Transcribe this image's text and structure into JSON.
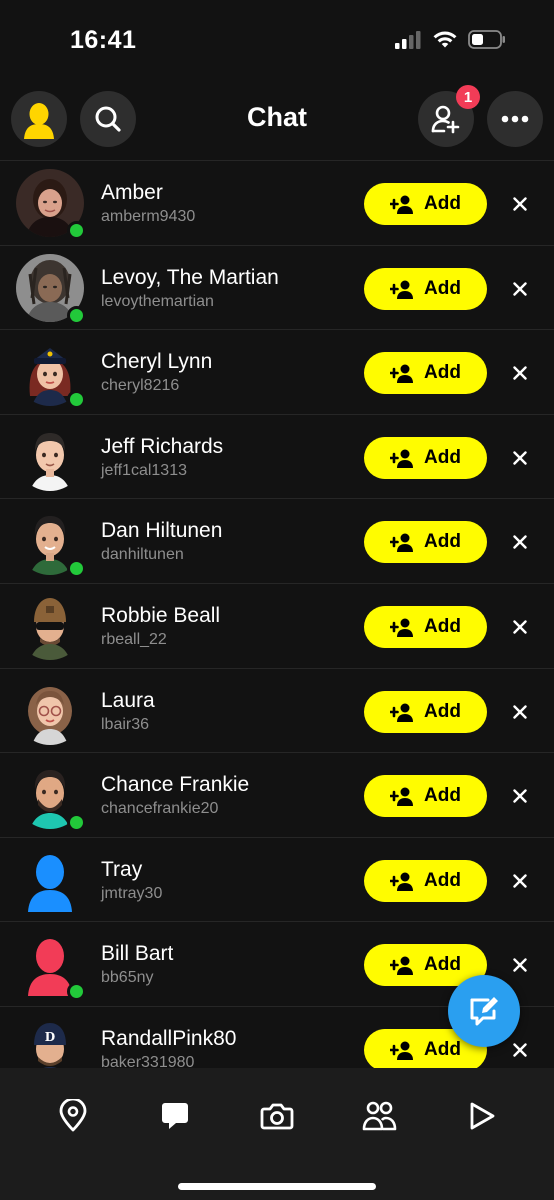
{
  "status_bar": {
    "time": "16:41"
  },
  "header": {
    "title": "Chat",
    "friend_request_badge": "1"
  },
  "add_label": "Add",
  "rows": [
    {
      "name": "Amber",
      "username": "amberm9430",
      "online": true,
      "avatar": "photo-woman"
    },
    {
      "name": "Levoy, The Martian",
      "username": "levoythemartian",
      "online": true,
      "avatar": "photo-man-gray"
    },
    {
      "name": "Cheryl Lynn",
      "username": "cheryl8216",
      "online": true,
      "avatar": "bitmoji-police-woman"
    },
    {
      "name": "Jeff Richards",
      "username": "jeff1cal1313",
      "online": false,
      "avatar": "bitmoji-man-white-shirt"
    },
    {
      "name": "Dan Hiltunen",
      "username": "danhiltunen",
      "online": true,
      "avatar": "bitmoji-man-green-shirt"
    },
    {
      "name": "Robbie Beall",
      "username": "rbeall_22",
      "online": false,
      "avatar": "bitmoji-man-beanie-sunglasses"
    },
    {
      "name": "Laura",
      "username": "lbair36",
      "online": false,
      "avatar": "bitmoji-woman-curly-hair"
    },
    {
      "name": "Chance Frankie",
      "username": "chancefrankie20",
      "online": true,
      "avatar": "bitmoji-man-beard"
    },
    {
      "name": "Tray",
      "username": "jmtray30",
      "online": false,
      "avatar": "silhouette-blue"
    },
    {
      "name": "Bill Bart",
      "username": "bb65ny",
      "online": true,
      "avatar": "silhouette-red"
    },
    {
      "name": "RandallPink80",
      "username": "baker331980",
      "online": false,
      "avatar": "bitmoji-man-cap"
    }
  ],
  "colors": {
    "background": "#121212",
    "accent_yellow": "#fffc00",
    "online_green": "#22c93a",
    "badge_red": "#f23c57",
    "fab_blue": "#2a9ff0",
    "silhouette_blue": "#1a8fff",
    "silhouette_red": "#f23c57"
  },
  "bottom_nav": [
    "map-icon",
    "chat-icon",
    "camera-icon",
    "friends-icon",
    "stories-icon"
  ]
}
